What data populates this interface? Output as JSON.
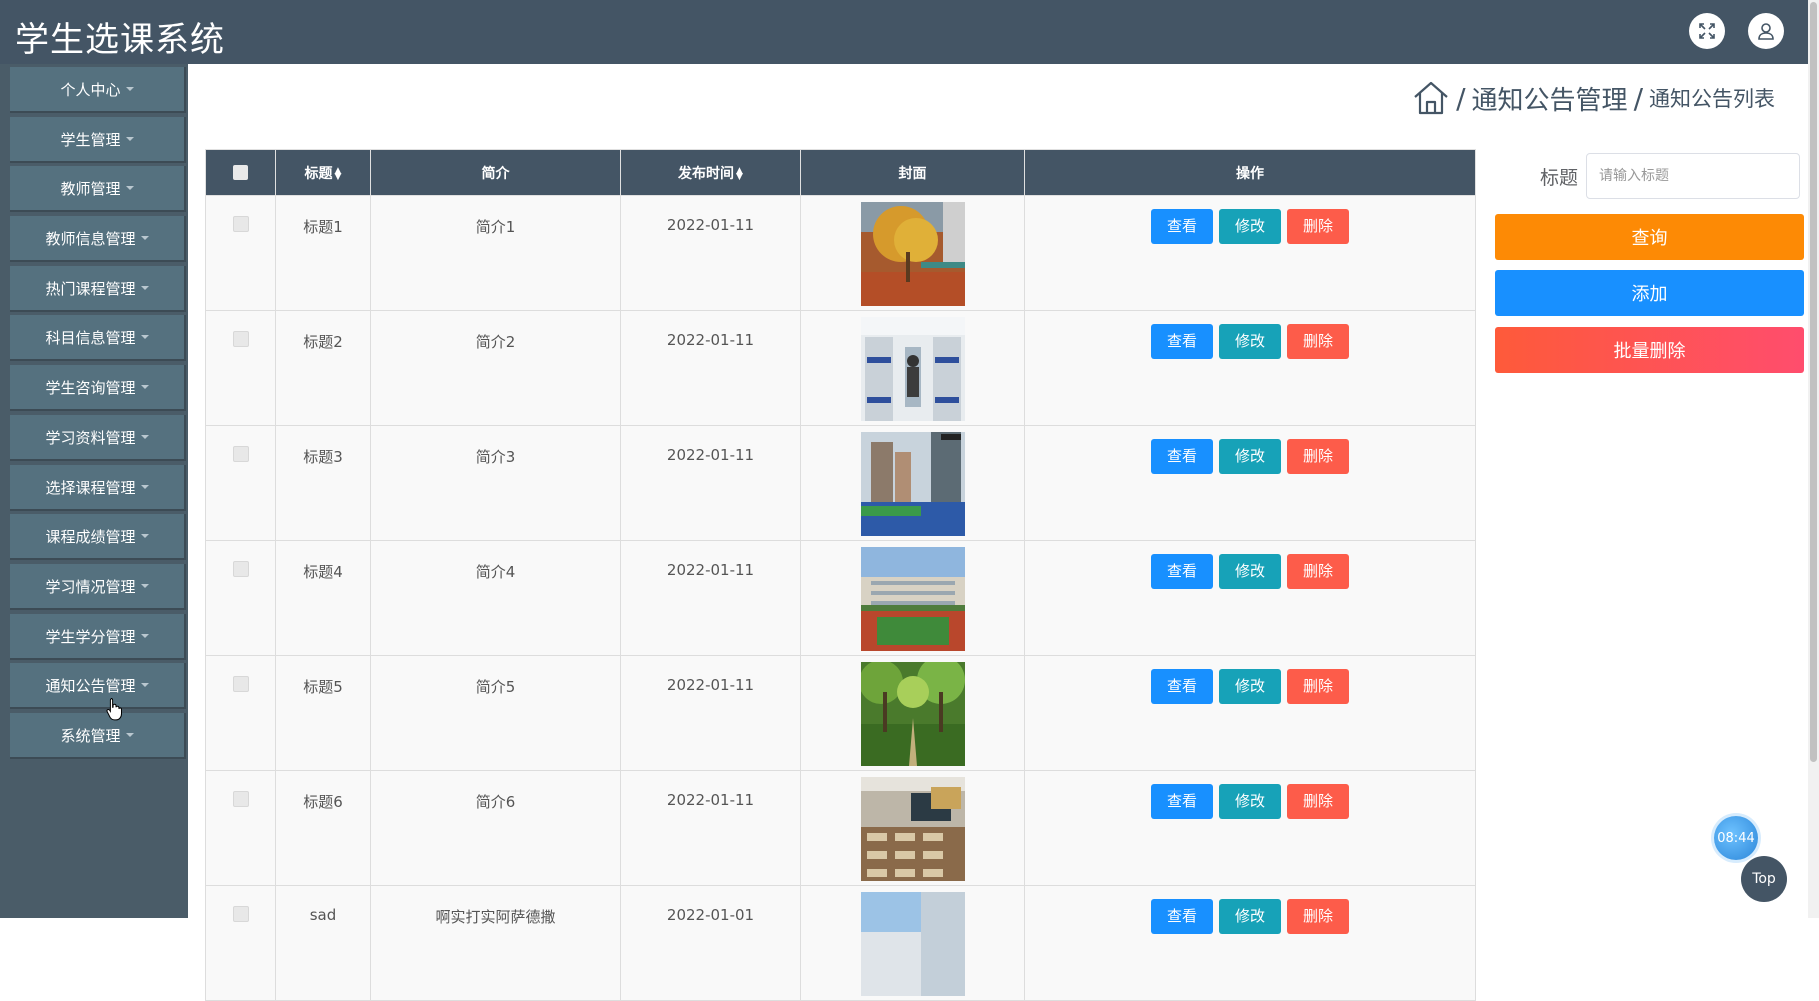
{
  "app": {
    "title": "学生选课系统"
  },
  "header_icons": {
    "fullscreen": "fullscreen-icon",
    "user": "user-icon"
  },
  "sidebar": {
    "items": [
      {
        "label": "个人中心"
      },
      {
        "label": "学生管理"
      },
      {
        "label": "教师管理"
      },
      {
        "label": "教师信息管理"
      },
      {
        "label": "热门课程管理"
      },
      {
        "label": "科目信息管理"
      },
      {
        "label": "学生咨询管理"
      },
      {
        "label": "学习资料管理"
      },
      {
        "label": "选择课程管理"
      },
      {
        "label": "课程成绩管理"
      },
      {
        "label": "学习情况管理"
      },
      {
        "label": "学生学分管理"
      },
      {
        "label": "通知公告管理"
      },
      {
        "label": "系统管理"
      }
    ]
  },
  "breadcrumb": {
    "sep": "/",
    "level1": "通知公告管理",
    "level2": "通知公告列表"
  },
  "table": {
    "headers": {
      "title": "标题",
      "intro": "简介",
      "time": "发布时间",
      "cover": "封面",
      "actions": "操作"
    },
    "rows": [
      {
        "title": "标题1",
        "intro": "简介1",
        "time": "2022-01-11",
        "cover": "autumn-tree"
      },
      {
        "title": "标题2",
        "intro": "简介2",
        "time": "2022-01-11",
        "cover": "dormitory"
      },
      {
        "title": "标题3",
        "intro": "简介3",
        "time": "2022-01-11",
        "cover": "campus-track"
      },
      {
        "title": "标题4",
        "intro": "简介4",
        "time": "2022-01-11",
        "cover": "stadium"
      },
      {
        "title": "标题5",
        "intro": "简介5",
        "time": "2022-01-11",
        "cover": "tree-path"
      },
      {
        "title": "标题6",
        "intro": "简介6",
        "time": "2022-01-11",
        "cover": "classroom"
      },
      {
        "title": "sad",
        "intro": "啊实打实阿萨德撒",
        "time": "2022-01-01",
        "cover": "building-sky"
      }
    ],
    "buttons": {
      "view": "查看",
      "edit": "修改",
      "delete": "删除"
    }
  },
  "search": {
    "label": "标题",
    "placeholder": "请输入标题",
    "value": ""
  },
  "actions": {
    "query": "查询",
    "add": "添加",
    "batch_delete": "批量删除"
  },
  "widgets": {
    "clock": "08:44",
    "top": "Top"
  },
  "colors": {
    "header": "#445565",
    "sidebar": "#4a5c68",
    "sidebar_item": "#55717f",
    "query": "#fd8a05",
    "add": "#1890ff",
    "batch_delete_from": "#fe5a3a",
    "batch_delete_to": "#ff4d6d",
    "view": "#1890ff",
    "edit": "#17a2b8",
    "delete": "#fd5c4a"
  }
}
